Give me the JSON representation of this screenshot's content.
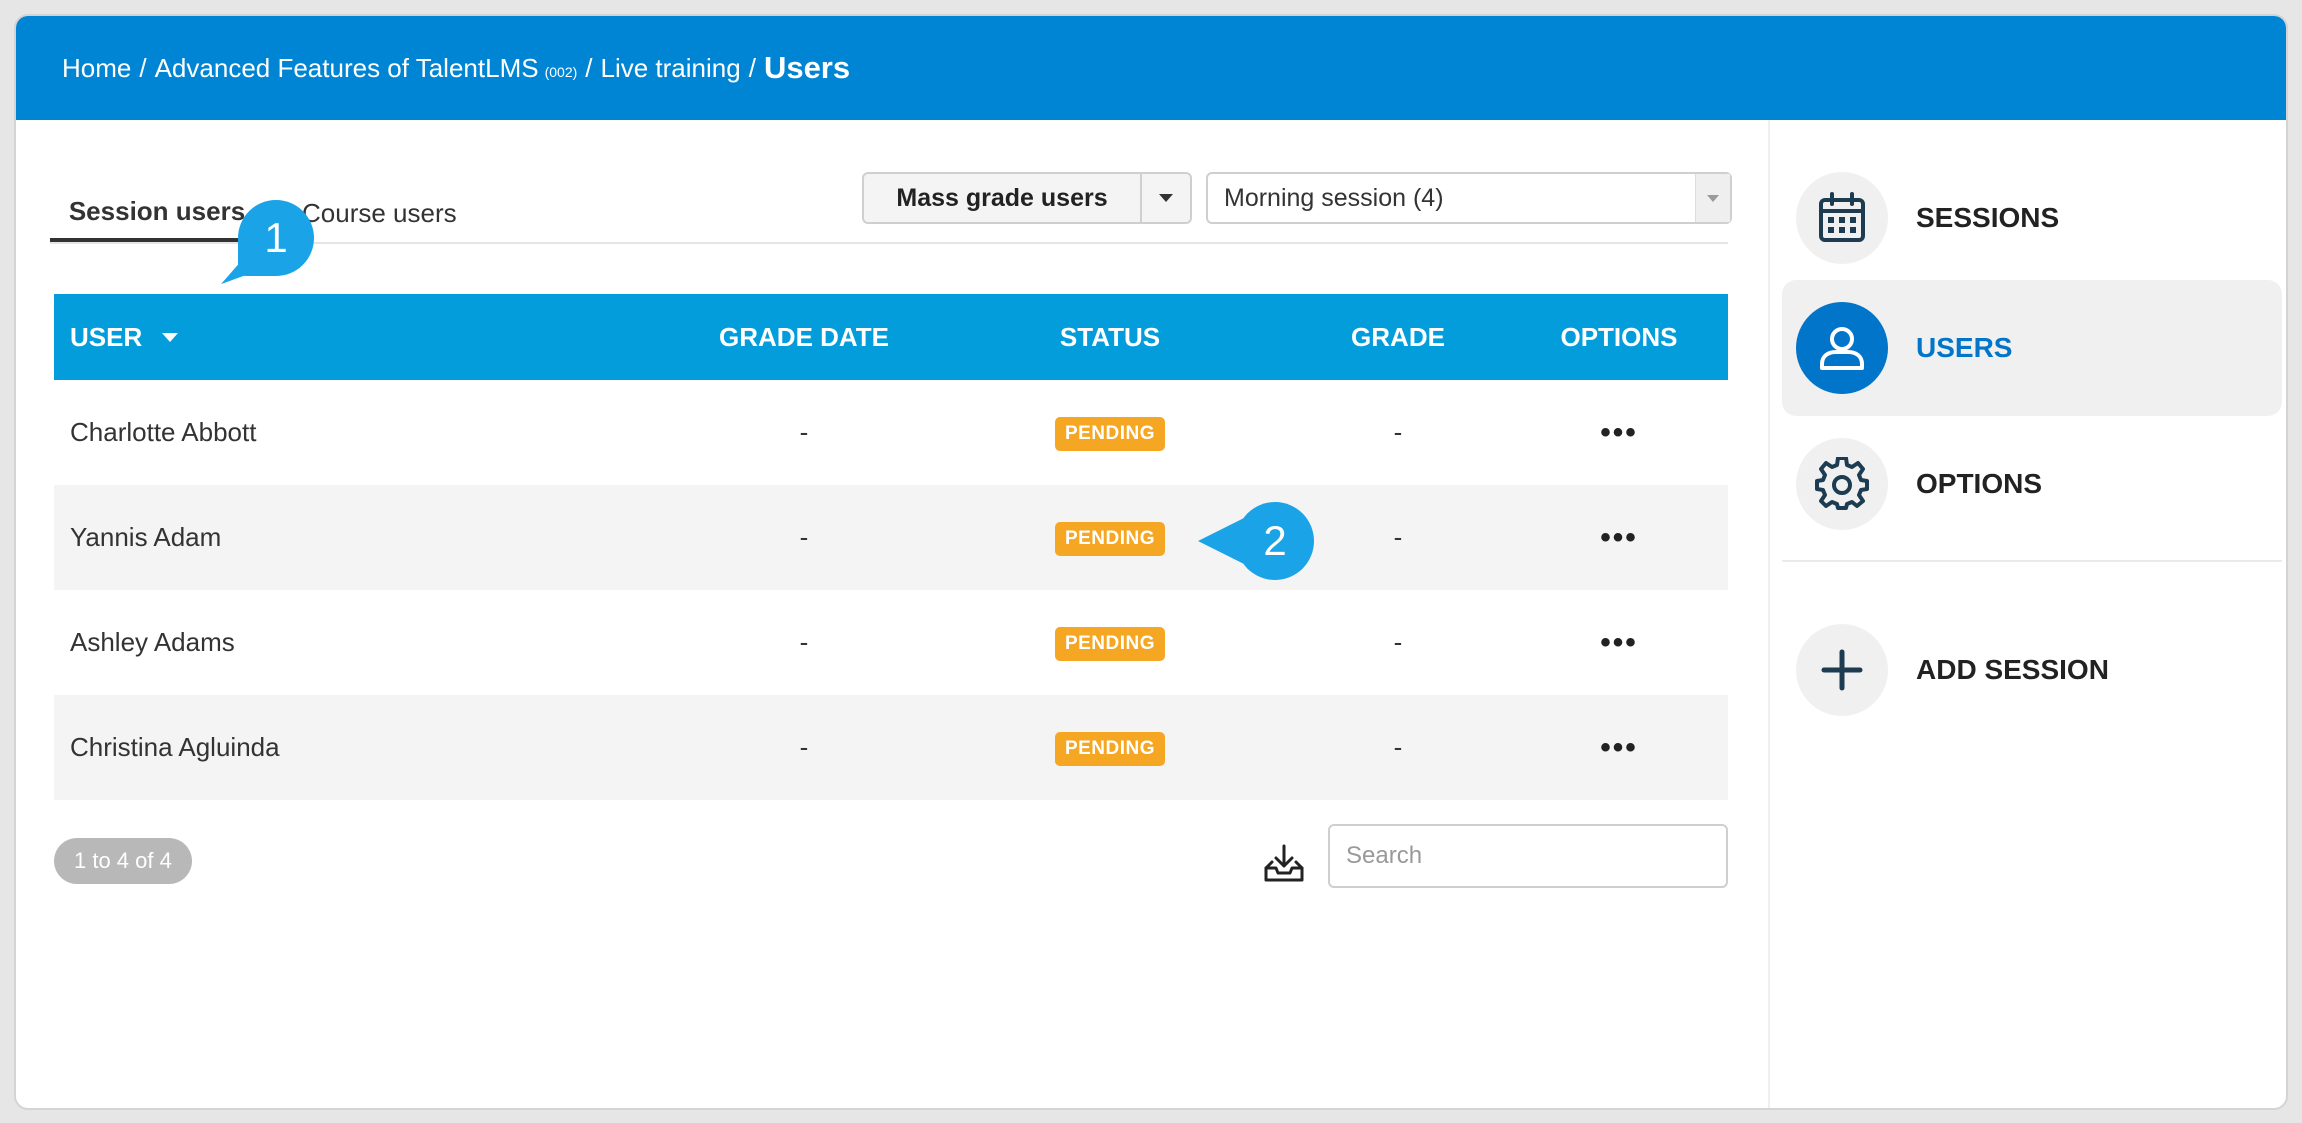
{
  "breadcrumb": {
    "home": "Home",
    "course": "Advanced Features of TalentLMS",
    "course_code": "(002)",
    "unit": "Live training",
    "current": "Users",
    "separator": "/"
  },
  "tabs": {
    "session_users": "Session users",
    "course_users": "Course users"
  },
  "toolbar": {
    "mass_grade_label": "Mass grade users",
    "session_select_value": "Morning session (4)"
  },
  "table": {
    "headers": {
      "user": "USER",
      "grade_date": "GRADE DATE",
      "status": "STATUS",
      "grade": "GRADE",
      "options": "OPTIONS"
    },
    "rows": [
      {
        "user": "Charlotte Abbott",
        "grade_date": "-",
        "status": "PENDING",
        "grade": "-",
        "options": "•••"
      },
      {
        "user": "Yannis Adam",
        "grade_date": "-",
        "status": "PENDING",
        "grade": "-",
        "options": "•••"
      },
      {
        "user": "Ashley Adams",
        "grade_date": "-",
        "status": "PENDING",
        "grade": "-",
        "options": "•••"
      },
      {
        "user": "Christina Agluinda",
        "grade_date": "-",
        "status": "PENDING",
        "grade": "-",
        "options": "•••"
      }
    ]
  },
  "pager": {
    "text": "1 to 4 of 4"
  },
  "search": {
    "placeholder": "Search"
  },
  "callouts": {
    "one": "1",
    "two": "2"
  },
  "sidebar": {
    "sessions": "SESSIONS",
    "users": "USERS",
    "options": "OPTIONS",
    "add_session": "ADD SESSION"
  },
  "icons": {
    "sessions": "calendar-icon",
    "users": "user-icon",
    "options": "gear-icon",
    "add_session": "plus-icon",
    "export": "download-tray-icon"
  },
  "colors": {
    "header_blue": "#0085d5",
    "table_header_blue": "#049ddb",
    "pending_badge": "#f5a623",
    "callout": "#1aa3e6",
    "active_blue": "#0075c9"
  }
}
